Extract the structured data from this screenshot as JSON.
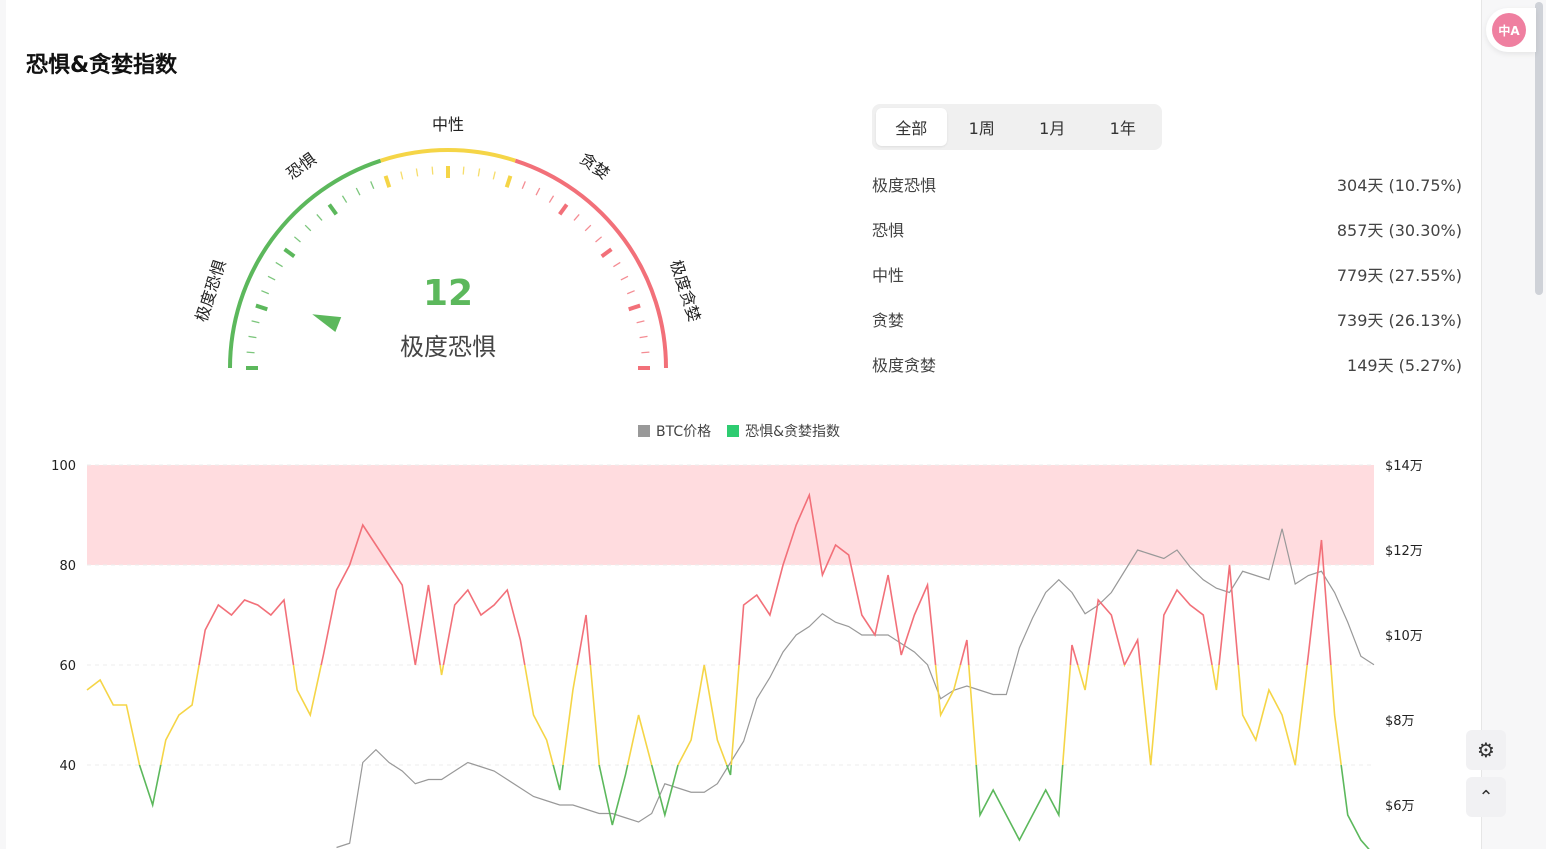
{
  "page": {
    "title": "恐惧&贪婪指数"
  },
  "gauge": {
    "value": 12,
    "status": "极度恐惧",
    "labels": [
      "极度恐惧",
      "恐惧",
      "中性",
      "贪婪",
      "极度贪婪"
    ],
    "colors": {
      "fear": "#5cb85c",
      "neutral": "#f5d547",
      "greed": "#f27079"
    }
  },
  "tabs": [
    {
      "label": "全部",
      "active": true
    },
    {
      "label": "1周"
    },
    {
      "label": "1月"
    },
    {
      "label": "1年"
    }
  ],
  "stats": [
    {
      "label": "极度恐惧",
      "value": "304天 (10.75%)"
    },
    {
      "label": "恐惧",
      "value": "857天 (30.30%)"
    },
    {
      "label": "中性",
      "value": "779天 (27.55%)"
    },
    {
      "label": "贪婪",
      "value": "739天 (26.13%)"
    },
    {
      "label": "极度贪婪",
      "value": "149天 (5.27%)"
    }
  ],
  "side": {
    "translate_label": "中A",
    "feedback_icon": "alert-badge-icon",
    "top_icon": "chevron-up-icon"
  },
  "chart_data": {
    "type": "line",
    "legend": [
      {
        "name": "BTC价格",
        "color": "#999999"
      },
      {
        "name": "恐惧&贪婪指数",
        "color": "#2ecc71"
      }
    ],
    "left_ticks": [
      "100",
      "80",
      "60",
      "40"
    ],
    "right_ticks": [
      "$14万",
      "$12万",
      "$10万",
      "$8万",
      "$6万"
    ],
    "left_range": [
      23,
      100
    ],
    "right_range_wan": [
      4,
      14
    ],
    "fg_index": [
      55,
      57,
      52,
      52,
      40,
      32,
      45,
      50,
      52,
      67,
      72,
      70,
      73,
      72,
      70,
      73,
      55,
      50,
      62,
      75,
      80,
      88,
      84,
      80,
      76,
      60,
      76,
      58,
      72,
      75,
      70,
      72,
      75,
      65,
      50,
      45,
      35,
      55,
      70,
      40,
      28,
      38,
      50,
      40,
      30,
      40,
      45,
      60,
      45,
      38,
      72,
      74,
      70,
      80,
      88,
      94,
      78,
      84,
      82,
      70,
      66,
      78,
      62,
      70,
      76,
      50,
      55,
      65,
      30,
      35,
      30,
      25,
      30,
      35,
      30,
      64,
      55,
      73,
      70,
      60,
      65,
      40,
      70,
      75,
      72,
      70,
      55,
      80,
      50,
      45,
      55,
      50,
      40,
      62,
      85,
      50,
      30,
      25,
      22
    ],
    "btc_price_wan": [
      null,
      null,
      null,
      null,
      null,
      null,
      null,
      null,
      null,
      null,
      null,
      null,
      null,
      null,
      null,
      null,
      null,
      null,
      null,
      5.0,
      5.1,
      7.0,
      7.3,
      7.0,
      6.8,
      6.5,
      6.6,
      6.6,
      6.8,
      7.0,
      6.9,
      6.8,
      6.6,
      6.4,
      6.2,
      6.1,
      6.0,
      6.0,
      5.9,
      5.8,
      5.8,
      5.7,
      5.6,
      5.8,
      6.5,
      6.4,
      6.3,
      6.3,
      6.5,
      7.0,
      7.5,
      8.5,
      9.0,
      9.6,
      10.0,
      10.2,
      10.5,
      10.3,
      10.2,
      10.0,
      10.0,
      10.0,
      9.8,
      9.6,
      9.3,
      8.5,
      8.7,
      8.8,
      8.7,
      8.6,
      8.6,
      9.7,
      10.4,
      11.0,
      11.3,
      11.0,
      10.5,
      10.7,
      11.0,
      11.5,
      12.0,
      11.9,
      11.8,
      12.0,
      11.6,
      11.3,
      11.1,
      11.0,
      11.5,
      11.4,
      11.3,
      12.5,
      11.2,
      11.4,
      11.5,
      11.0,
      10.3,
      9.5,
      9.3
    ]
  }
}
